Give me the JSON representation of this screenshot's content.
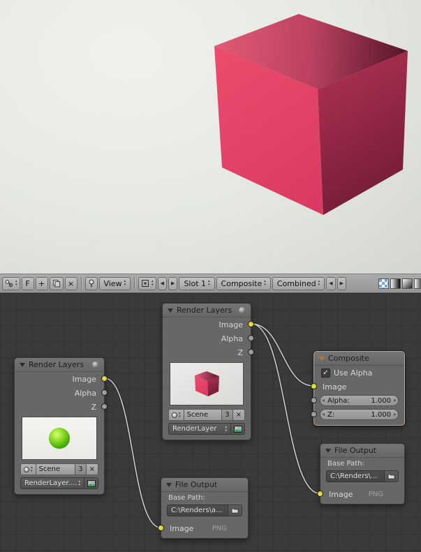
{
  "header": {
    "fake_user_label": "F",
    "view_menu_label": "View",
    "slot_value": "Slot 1",
    "render_layer_value": "Composite",
    "render_pass_value": "Combined"
  },
  "icons": {
    "check": "✓",
    "close": "×",
    "plus": "+",
    "left_arrow": "◀",
    "right_arrow": "▶",
    "up_small": "▴",
    "down_small": "▾",
    "tri_left": "◂",
    "tri_right": "▸"
  },
  "nodes": {
    "render_layers_left": {
      "title": "Render Layers",
      "outputs": [
        "Image",
        "Alpha",
        "Z"
      ],
      "scene_label": "Scene",
      "user_count": "3",
      "layer_value": "RenderLayer...."
    },
    "render_layers_center": {
      "title": "Render Layers",
      "outputs": [
        "Image",
        "Alpha",
        "Z"
      ],
      "scene_label": "Scene",
      "user_count": "3",
      "layer_value": "RenderLayer"
    },
    "composite": {
      "title": "Composite",
      "use_alpha": "Use Alpha",
      "input_image": "Image",
      "alpha_label": "Alpha:",
      "alpha_value": "1.000",
      "z_label": "Z:",
      "z_value": "1.000"
    },
    "file_output_bottom": {
      "title": "File Output",
      "base_path_label": "Base Path:",
      "path": "C:\\Renders\\a...",
      "input_image": "Image",
      "format": "PNG"
    },
    "file_output_right": {
      "title": "File Output",
      "base_path_label": "Base Path:",
      "path": "C:\\Renders\\...",
      "input_image": "Image",
      "format": "PNG"
    }
  },
  "colors": {
    "selected_outline": "#ee9c2c",
    "socket_image": "#dedc3a",
    "socket_value": "#9d9d9d",
    "cube_pink": "#e4466a"
  }
}
